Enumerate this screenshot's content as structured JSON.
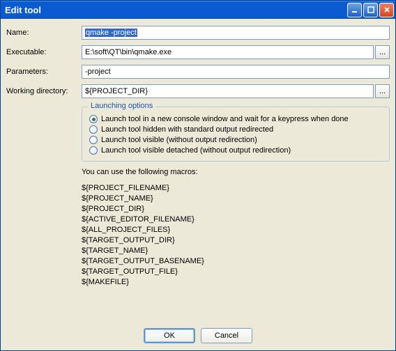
{
  "window": {
    "title": "Edit tool"
  },
  "labels": {
    "name": "Name:",
    "executable": "Executable:",
    "parameters": "Parameters:",
    "workdir": "Working directory:"
  },
  "fields": {
    "name": "qmake -project",
    "executable": "E:\\soft\\QT\\bin\\qmake.exe",
    "parameters": "-project",
    "workdir": "${PROJECT_DIR}"
  },
  "browse_label": "...",
  "launch": {
    "legend": "Launching options",
    "options": [
      "Launch tool in a new console window and wait for a keypress when done",
      "Launch tool hidden with standard output redirected",
      "Launch tool visible (without output redirection)",
      "Launch tool visible detached (without output redirection)"
    ],
    "selected": 0
  },
  "macros": {
    "intro": "You can use the following macros:",
    "list": [
      "${PROJECT_FILENAME}",
      "${PROJECT_NAME}",
      "${PROJECT_DIR}",
      "${ACTIVE_EDITOR_FILENAME}",
      "${ALL_PROJECT_FILES}",
      "${TARGET_OUTPUT_DIR}",
      "${TARGET_NAME}",
      "${TARGET_OUTPUT_BASENAME}",
      "${TARGET_OUTPUT_FILE}",
      "${MAKEFILE}"
    ]
  },
  "buttons": {
    "ok": "OK",
    "cancel": "Cancel"
  }
}
